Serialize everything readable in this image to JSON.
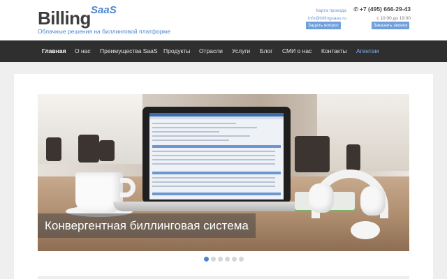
{
  "header": {
    "logo": {
      "main": "Billing",
      "accent": "SaaS"
    },
    "tagline": "Облачные решения на биллинговой платформе",
    "links": {
      "map": "Карта проезда",
      "email": "info@billingsaas.ru"
    },
    "ask_button": "Задать вопрос",
    "phone": "+7 (495) 666-29-43",
    "hours": "с 10:00 до 19:00",
    "call_button": "Заказать звонок"
  },
  "nav": {
    "items": [
      "Главная",
      "О нас",
      "Преимущества SaaS",
      "Продукты",
      "Отрасли",
      "Услуги",
      "Блог",
      "СМИ о нас",
      "Контакты",
      "Агентам"
    ],
    "active_index": 0
  },
  "slider": {
    "caption": "Конвергентная биллинговая система",
    "slide_count": 6,
    "active_slide": 1
  },
  "colors": {
    "accent": "#4d86cc",
    "nav_bg": "#2f2f2f",
    "button": "#6f9fdb"
  }
}
